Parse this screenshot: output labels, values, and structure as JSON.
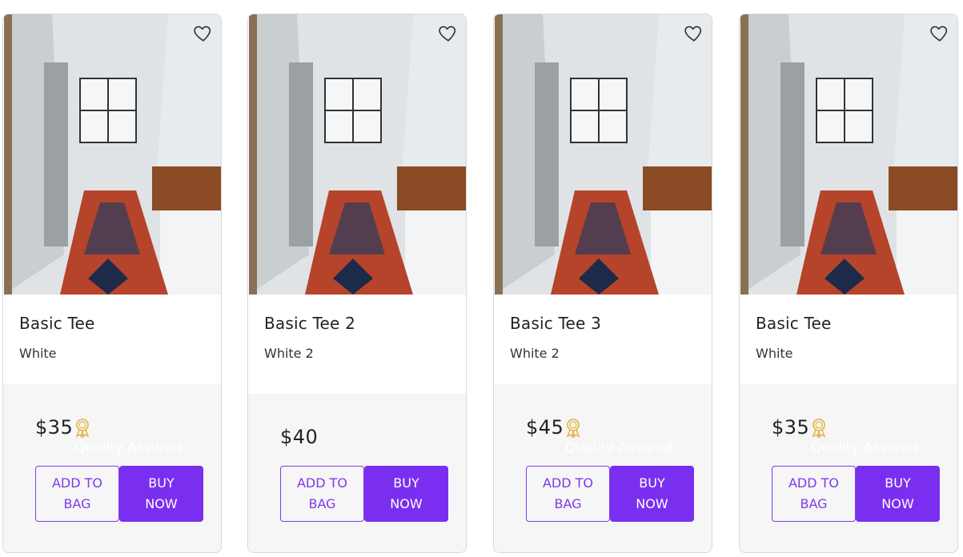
{
  "products": [
    {
      "title": "Basic Tee",
      "color": "White",
      "price": "$35",
      "quality_badge": true,
      "quality_label": "Quality Assured",
      "add_to_bag_label": "ADD TO BAG",
      "buy_now_label": "BUY NOW"
    },
    {
      "title": "Basic Tee 2",
      "color": "White 2",
      "price": "$40",
      "quality_badge": false,
      "add_to_bag_label": "ADD TO BAG",
      "buy_now_label": "BUY NOW"
    },
    {
      "title": "Basic Tee 3",
      "color": "White 2",
      "price": "$45",
      "quality_badge": true,
      "quality_label": "Quality Assured",
      "add_to_bag_label": "ADD TO BAG",
      "buy_now_label": "BUY NOW"
    },
    {
      "title": "Basic Tee",
      "color": "White",
      "price": "$35",
      "quality_badge": true,
      "quality_label": "Quality Assured",
      "add_to_bag_label": "ADD TO BAG",
      "buy_now_label": "BUY NOW"
    }
  ],
  "icons": {
    "wishlist": "heart-outline-icon",
    "quality": "ribbon-badge-icon"
  },
  "colors": {
    "accent": "#7a2ff0",
    "badge": "#e3b23c",
    "footer_bg": "#f6f6f6"
  }
}
